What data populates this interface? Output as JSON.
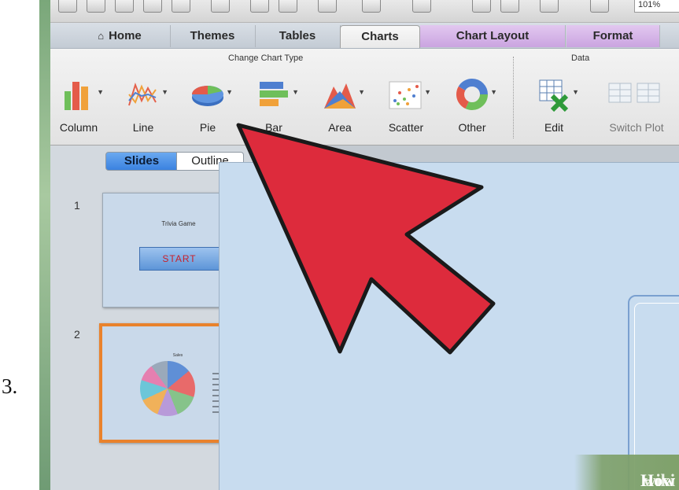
{
  "step_number": "3.",
  "toolbar": {
    "zoom_value": "101%"
  },
  "tabs": [
    {
      "label": "Home"
    },
    {
      "label": "Themes"
    },
    {
      "label": "Tables"
    },
    {
      "label": "Charts"
    },
    {
      "label": "Chart Layout"
    },
    {
      "label": "Format"
    }
  ],
  "ribbon": {
    "change_chart_type_title": "Change Chart Type",
    "data_title": "Data",
    "chart_buttons": [
      {
        "label": "Column",
        "icon": "column-chart-icon"
      },
      {
        "label": "Line",
        "icon": "line-chart-icon"
      },
      {
        "label": "Pie",
        "icon": "pie-chart-icon"
      },
      {
        "label": "Bar",
        "icon": "bar-chart-icon"
      },
      {
        "label": "Area",
        "icon": "area-chart-icon"
      },
      {
        "label": "Scatter",
        "icon": "scatter-chart-icon"
      },
      {
        "label": "Other",
        "icon": "donut-chart-icon"
      }
    ],
    "data_buttons": [
      {
        "label": "Edit",
        "icon": "edit-data-icon"
      },
      {
        "label": "Switch Plot",
        "icon": "switch-plot-icon"
      }
    ]
  },
  "sidebar": {
    "segment_slides": "Slides",
    "segment_outline": "Outline",
    "slides": [
      {
        "number": "1",
        "title": "Trivia Game",
        "button": "START"
      },
      {
        "number": "2",
        "title": "Sales"
      }
    ]
  },
  "watermark": {
    "part1": "wiki",
    "part2": "How"
  },
  "colors": {
    "arrow": "#dd2b3c",
    "selection": "#e9822c",
    "slides_segment": "#3b82e0"
  }
}
